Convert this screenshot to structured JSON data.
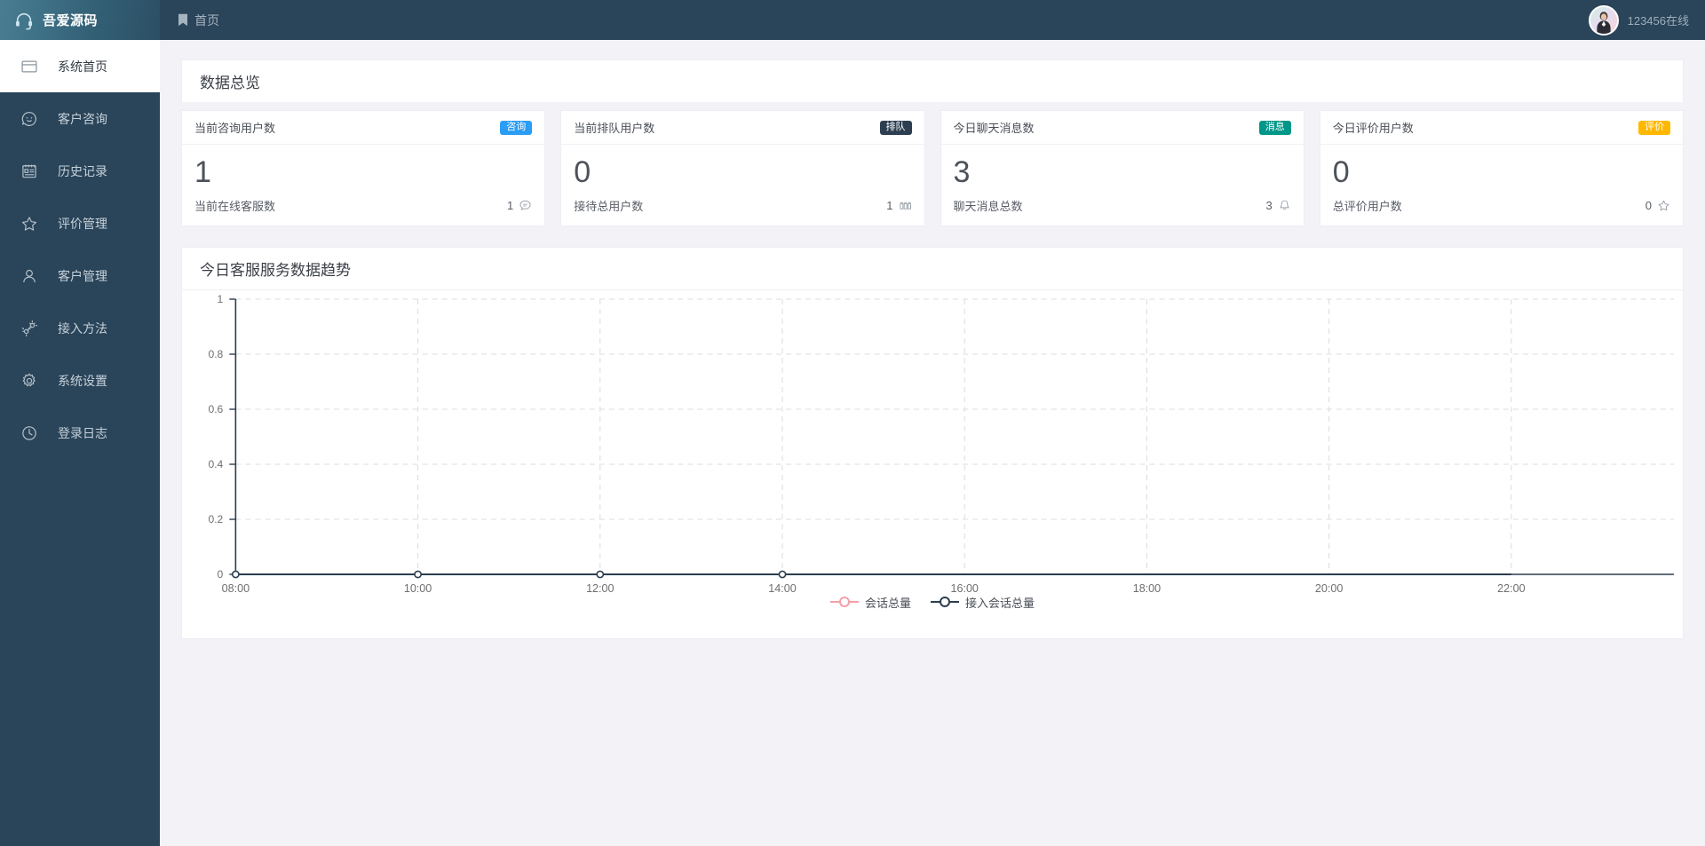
{
  "brand": {
    "name": "吾爱源码",
    "logo_icon": "headset-icon"
  },
  "sidebar": {
    "items": [
      {
        "label": "系统首页",
        "icon": "window-icon",
        "active": true
      },
      {
        "label": "客户咨询",
        "icon": "smiley-chat-icon",
        "active": false
      },
      {
        "label": "历史记录",
        "icon": "note-list-icon",
        "active": false
      },
      {
        "label": "评价管理",
        "icon": "star-icon",
        "active": false
      },
      {
        "label": "客户管理",
        "icon": "user-icon",
        "active": false
      },
      {
        "label": "接入方法",
        "icon": "connect-icon",
        "active": false
      },
      {
        "label": "系统设置",
        "icon": "gear-icon",
        "active": false
      },
      {
        "label": "登录日志",
        "icon": "clock-icon",
        "active": false
      }
    ]
  },
  "topbar": {
    "breadcrumb": "首页",
    "breadcrumb_icon": "bookmark-icon",
    "user_label": "123456在线",
    "avatar_icon": "avatar"
  },
  "overview": {
    "title": "数据总览",
    "cards": [
      {
        "label": "当前咨询用户数",
        "badge": "咨询",
        "badge_color": "#2b9df4",
        "value": "1",
        "foot_label": "当前在线客服数",
        "foot_value": "1",
        "foot_icon": "chat-bubble-icon"
      },
      {
        "label": "当前排队用户数",
        "badge": "排队",
        "badge_color": "#2c3e50",
        "value": "0",
        "foot_label": "接待总用户数",
        "foot_value": "1",
        "foot_icon": "queue-icon"
      },
      {
        "label": "今日聊天消息数",
        "badge": "消息",
        "badge_color": "#009688",
        "value": "3",
        "foot_label": "聊天消息总数",
        "foot_value": "3",
        "foot_icon": "bell-icon"
      },
      {
        "label": "今日评价用户数",
        "badge": "评价",
        "badge_color": "#ffb800",
        "value": "0",
        "foot_label": "总评价用户数",
        "foot_value": "0",
        "foot_icon": "star-outline-icon"
      }
    ]
  },
  "trend": {
    "title": "今日客服服务数据趋势"
  },
  "chart_data": {
    "type": "line",
    "title": "今日客服服务数据趋势",
    "xlabel": "",
    "ylabel": "",
    "x": [
      "08:00",
      "10:00",
      "12:00",
      "14:00",
      "16:00",
      "18:00",
      "20:00",
      "22:00"
    ],
    "yticks": [
      "0",
      "0.2",
      "0.4",
      "0.6",
      "0.8",
      "1"
    ],
    "ylim": [
      0,
      1
    ],
    "grid": true,
    "legend_position": "bottom",
    "series": [
      {
        "name": "会话总量",
        "color": "#f4a0a8",
        "values": [
          0,
          0,
          0,
          0,
          0,
          0,
          0,
          0
        ]
      },
      {
        "name": "接入会话总量",
        "color": "#2c3e50",
        "values": [
          0,
          0,
          0,
          0,
          0,
          0,
          0,
          0
        ]
      }
    ]
  }
}
